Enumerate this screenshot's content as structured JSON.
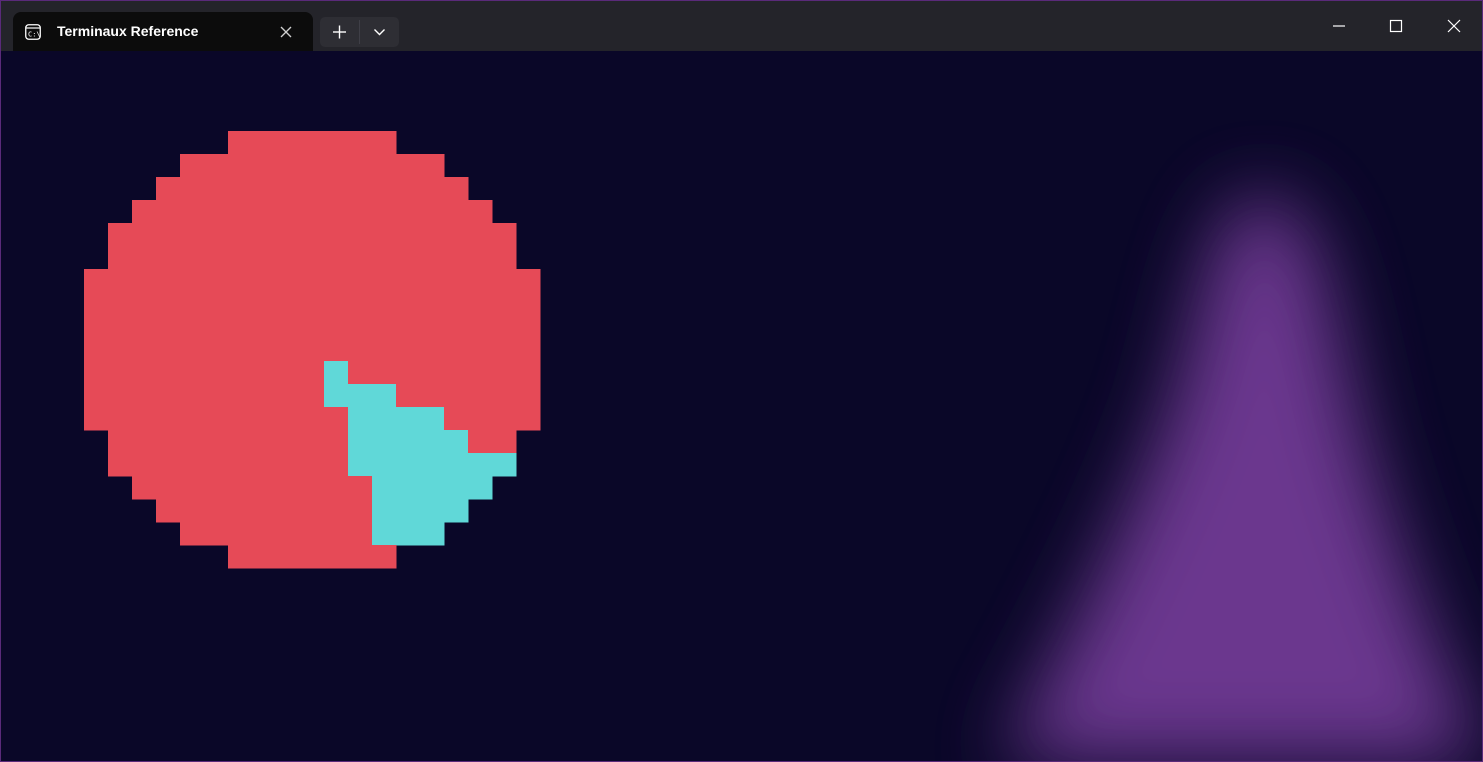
{
  "window": {
    "tab_title": "Terminaux Reference",
    "tab_icon": "terminal-icon",
    "buttons": {
      "close_tab": "close-icon",
      "new_tab": "plus-icon",
      "dropdown": "chevron-down-icon",
      "minimize": "minimize-icon",
      "maximize": "maximize-icon",
      "close": "close-icon"
    }
  },
  "colors": {
    "background": "#0a0728",
    "titlebar": "#24242a",
    "pie_red": "#e64a57",
    "pie_cyan": "#60d8d8",
    "glow": "#7b3fa0"
  },
  "chart_data": {
    "type": "pie",
    "style": "block-pixel",
    "series": [
      {
        "color": "#e64a57",
        "value": 0.89
      },
      {
        "color": "#60d8d8",
        "value": 0.11
      }
    ]
  }
}
